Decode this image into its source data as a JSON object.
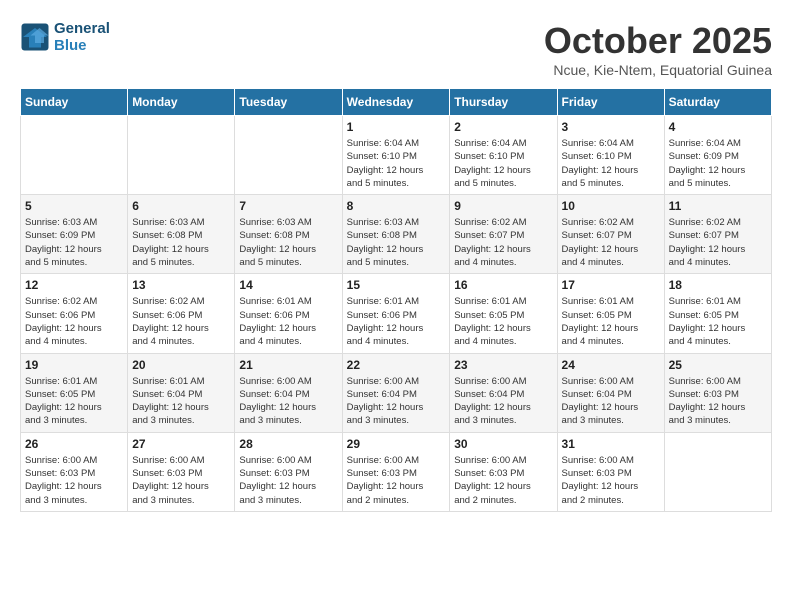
{
  "logo": {
    "line1": "General",
    "line2": "Blue"
  },
  "title": {
    "month_year": "October 2025",
    "location": "Ncue, Kie-Ntem, Equatorial Guinea"
  },
  "header": {
    "days": [
      "Sunday",
      "Monday",
      "Tuesday",
      "Wednesday",
      "Thursday",
      "Friday",
      "Saturday"
    ]
  },
  "weeks": [
    {
      "cells": [
        {
          "day": "",
          "info": ""
        },
        {
          "day": "",
          "info": ""
        },
        {
          "day": "",
          "info": ""
        },
        {
          "day": "1",
          "info": "Sunrise: 6:04 AM\nSunset: 6:10 PM\nDaylight: 12 hours\nand 5 minutes."
        },
        {
          "day": "2",
          "info": "Sunrise: 6:04 AM\nSunset: 6:10 PM\nDaylight: 12 hours\nand 5 minutes."
        },
        {
          "day": "3",
          "info": "Sunrise: 6:04 AM\nSunset: 6:10 PM\nDaylight: 12 hours\nand 5 minutes."
        },
        {
          "day": "4",
          "info": "Sunrise: 6:04 AM\nSunset: 6:09 PM\nDaylight: 12 hours\nand 5 minutes."
        }
      ]
    },
    {
      "cells": [
        {
          "day": "5",
          "info": "Sunrise: 6:03 AM\nSunset: 6:09 PM\nDaylight: 12 hours\nand 5 minutes."
        },
        {
          "day": "6",
          "info": "Sunrise: 6:03 AM\nSunset: 6:08 PM\nDaylight: 12 hours\nand 5 minutes."
        },
        {
          "day": "7",
          "info": "Sunrise: 6:03 AM\nSunset: 6:08 PM\nDaylight: 12 hours\nand 5 minutes."
        },
        {
          "day": "8",
          "info": "Sunrise: 6:03 AM\nSunset: 6:08 PM\nDaylight: 12 hours\nand 5 minutes."
        },
        {
          "day": "9",
          "info": "Sunrise: 6:02 AM\nSunset: 6:07 PM\nDaylight: 12 hours\nand 4 minutes."
        },
        {
          "day": "10",
          "info": "Sunrise: 6:02 AM\nSunset: 6:07 PM\nDaylight: 12 hours\nand 4 minutes."
        },
        {
          "day": "11",
          "info": "Sunrise: 6:02 AM\nSunset: 6:07 PM\nDaylight: 12 hours\nand 4 minutes."
        }
      ]
    },
    {
      "cells": [
        {
          "day": "12",
          "info": "Sunrise: 6:02 AM\nSunset: 6:06 PM\nDaylight: 12 hours\nand 4 minutes."
        },
        {
          "day": "13",
          "info": "Sunrise: 6:02 AM\nSunset: 6:06 PM\nDaylight: 12 hours\nand 4 minutes."
        },
        {
          "day": "14",
          "info": "Sunrise: 6:01 AM\nSunset: 6:06 PM\nDaylight: 12 hours\nand 4 minutes."
        },
        {
          "day": "15",
          "info": "Sunrise: 6:01 AM\nSunset: 6:06 PM\nDaylight: 12 hours\nand 4 minutes."
        },
        {
          "day": "16",
          "info": "Sunrise: 6:01 AM\nSunset: 6:05 PM\nDaylight: 12 hours\nand 4 minutes."
        },
        {
          "day": "17",
          "info": "Sunrise: 6:01 AM\nSunset: 6:05 PM\nDaylight: 12 hours\nand 4 minutes."
        },
        {
          "day": "18",
          "info": "Sunrise: 6:01 AM\nSunset: 6:05 PM\nDaylight: 12 hours\nand 4 minutes."
        }
      ]
    },
    {
      "cells": [
        {
          "day": "19",
          "info": "Sunrise: 6:01 AM\nSunset: 6:05 PM\nDaylight: 12 hours\nand 3 minutes."
        },
        {
          "day": "20",
          "info": "Sunrise: 6:01 AM\nSunset: 6:04 PM\nDaylight: 12 hours\nand 3 minutes."
        },
        {
          "day": "21",
          "info": "Sunrise: 6:00 AM\nSunset: 6:04 PM\nDaylight: 12 hours\nand 3 minutes."
        },
        {
          "day": "22",
          "info": "Sunrise: 6:00 AM\nSunset: 6:04 PM\nDaylight: 12 hours\nand 3 minutes."
        },
        {
          "day": "23",
          "info": "Sunrise: 6:00 AM\nSunset: 6:04 PM\nDaylight: 12 hours\nand 3 minutes."
        },
        {
          "day": "24",
          "info": "Sunrise: 6:00 AM\nSunset: 6:04 PM\nDaylight: 12 hours\nand 3 minutes."
        },
        {
          "day": "25",
          "info": "Sunrise: 6:00 AM\nSunset: 6:03 PM\nDaylight: 12 hours\nand 3 minutes."
        }
      ]
    },
    {
      "cells": [
        {
          "day": "26",
          "info": "Sunrise: 6:00 AM\nSunset: 6:03 PM\nDaylight: 12 hours\nand 3 minutes."
        },
        {
          "day": "27",
          "info": "Sunrise: 6:00 AM\nSunset: 6:03 PM\nDaylight: 12 hours\nand 3 minutes."
        },
        {
          "day": "28",
          "info": "Sunrise: 6:00 AM\nSunset: 6:03 PM\nDaylight: 12 hours\nand 3 minutes."
        },
        {
          "day": "29",
          "info": "Sunrise: 6:00 AM\nSunset: 6:03 PM\nDaylight: 12 hours\nand 2 minutes."
        },
        {
          "day": "30",
          "info": "Sunrise: 6:00 AM\nSunset: 6:03 PM\nDaylight: 12 hours\nand 2 minutes."
        },
        {
          "day": "31",
          "info": "Sunrise: 6:00 AM\nSunset: 6:03 PM\nDaylight: 12 hours\nand 2 minutes."
        },
        {
          "day": "",
          "info": ""
        }
      ]
    }
  ]
}
